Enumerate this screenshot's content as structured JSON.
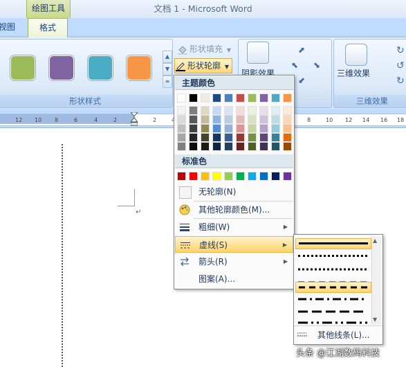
{
  "window": {
    "title": "文档 1 - Microsoft Word",
    "context_tab_group": "绘图工具"
  },
  "tabs": [
    {
      "label": "视图"
    },
    {
      "label": "格式"
    }
  ],
  "ribbon": {
    "shape_styles_label": "形状样式",
    "swatches": [
      "#9bbb59",
      "#8064a2",
      "#4bacc6",
      "#f79646"
    ],
    "shape_fill": "形状填充",
    "shape_outline": "形状轮廓",
    "shadow_effects": "阴影效果",
    "three_d_effects": "三维效果",
    "three_d_group_label": "三维效果"
  },
  "ruler": {
    "ticks": [
      "12",
      "10",
      "8",
      "6",
      "4",
      "2",
      "2",
      "4",
      "8",
      "10",
      "12",
      "14",
      "16",
      "18"
    ]
  },
  "menu": {
    "theme_colors_label": "主题颜色",
    "theme_top_row": [
      "#ffffff",
      "#000000",
      "#eeece1",
      "#1f497d",
      "#4f81bd",
      "#c0504d",
      "#9bbb59",
      "#8064a2",
      "#4bacc6",
      "#f79646"
    ],
    "theme_columns": [
      [
        "#f2f2f2",
        "#d9d9d9",
        "#bfbfbf",
        "#a6a6a6",
        "#808080"
      ],
      [
        "#7f7f7f",
        "#595959",
        "#404040",
        "#262626",
        "#0d0d0d"
      ],
      [
        "#ddd9c3",
        "#c4bd97",
        "#938953",
        "#494429",
        "#1d1b10"
      ],
      [
        "#c6d9f0",
        "#8db3e2",
        "#548dd4",
        "#17365d",
        "#0f243e"
      ],
      [
        "#dbe5f1",
        "#b8cce4",
        "#95b3d7",
        "#366092",
        "#244061"
      ],
      [
        "#f2dcdb",
        "#e5b9b7",
        "#d99694",
        "#953734",
        "#632423"
      ],
      [
        "#ebf1dd",
        "#d7e3bc",
        "#c3d69b",
        "#76923c",
        "#4f6128"
      ],
      [
        "#e5e0ec",
        "#ccc1d9",
        "#b2a2c7",
        "#5f497a",
        "#3f3151"
      ],
      [
        "#dbeef3",
        "#b7dde8",
        "#92cddc",
        "#31859b",
        "#205867"
      ],
      [
        "#fdeada",
        "#fbd5b5",
        "#fac08f",
        "#e36c09",
        "#974806"
      ]
    ],
    "standard_colors_label": "标准色",
    "standard_colors": [
      "#c00000",
      "#ff0000",
      "#ffc000",
      "#ffff00",
      "#92d050",
      "#00b050",
      "#00b0f0",
      "#0070c0",
      "#002060",
      "#7030a0"
    ],
    "no_outline": "无轮廓(N)",
    "more_colors": "其他轮廓颜色(M)...",
    "weight": "粗细(W)",
    "dashes": "虚线(S)",
    "arrows": "箭头(R)",
    "pattern": "图案(A)..."
  },
  "submenu": {
    "more_lines": "其他线条(L)..."
  },
  "watermark": "头条 @江湖数码科技"
}
